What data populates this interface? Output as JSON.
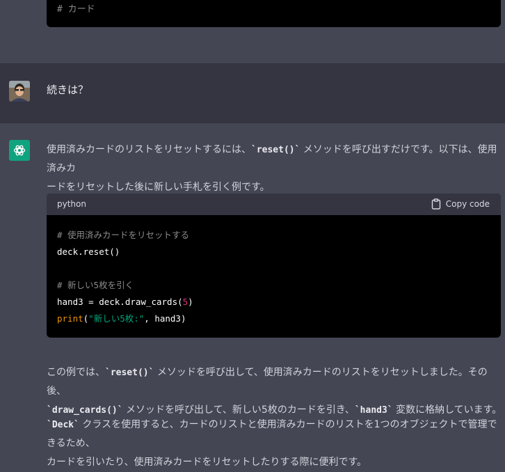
{
  "top_code": {
    "comment": "# カード"
  },
  "user_message": {
    "text": "続きは？"
  },
  "assistant": {
    "para1_a": "使用済みカードのリストをリセットするには、",
    "para1_code": "`reset()`",
    "para1_b": " メソッドを呼び出すだけです。以下は、使用済みカ",
    "para1_c": "ードをリセットした後に新しい手札を引く例です。",
    "code": {
      "language": "python",
      "copy_label": "Copy code",
      "line1": "# 使用済みカードをリセットする",
      "line2": "deck.reset()",
      "line4": "# 新しい5枚を引く",
      "line5_a": "hand3 = deck.draw_cards(",
      "line5_num": "5",
      "line5_b": ")",
      "line6_kw": "print",
      "line6_a": "(",
      "line6_str": "\"新しい5枚:\"",
      "line6_b": ", hand3)"
    },
    "para2_a": "この例では、",
    "para2_code1": "`reset()`",
    "para2_b": " メソッドを呼び出して、使用済みカードのリストをリセットしました。その後、",
    "para2_code2": "`draw_cards()`",
    "para2_c": " メソッドを呼び出して、新しい5枚のカードを引き、",
    "para2_code3": "`hand3`",
    "para2_d": " 変数に格納しています。",
    "para3_code": "`Deck`",
    "para3_a": " クラスを使用すると、カードのリストと使用済みカードのリストを1つのオブジェクトで管理できるため、",
    "para3_b": "カードを引いたり、使用済みカードをリセットしたりする際に便利です。"
  },
  "colors": {
    "accent": "#10a37f",
    "background": "#444654",
    "user_background": "#343541"
  }
}
